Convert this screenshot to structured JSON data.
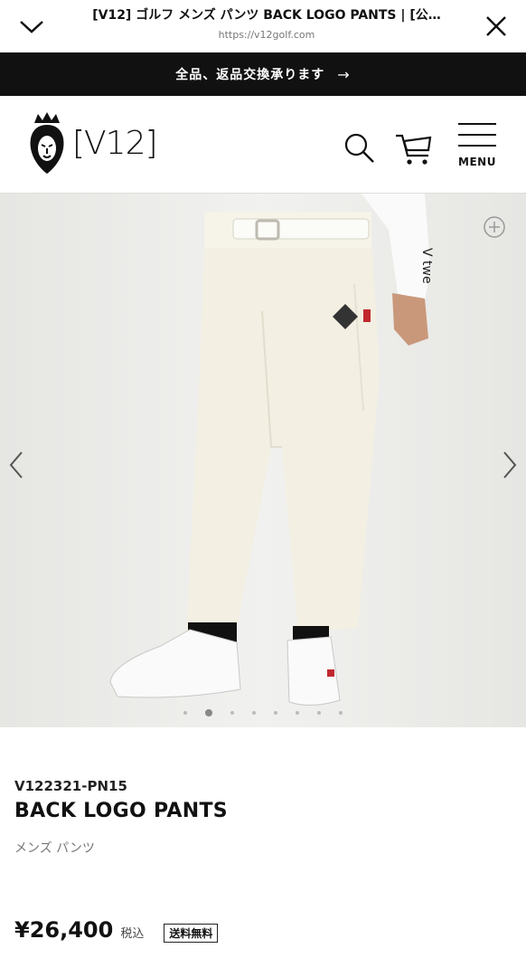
{
  "browser": {
    "title": "[V12] ゴルフ メンズ パンツ BACK LOGO PANTS | [公…",
    "url": "https://v12golf.com"
  },
  "announcement": {
    "text": "全品、返品交換承ります",
    "arrow": "→"
  },
  "site": {
    "logo": "[V12]",
    "menu_label": "MENU"
  },
  "gallery": {
    "image_count": 8,
    "active_index": 1
  },
  "product": {
    "sku": "V122321-PN15",
    "name": "BACK LOGO PANTS",
    "category": "メンズ パンツ",
    "price": "¥26,400",
    "tax_label": "税込",
    "shipping_badge": "送料無料"
  },
  "colors": {
    "announce_bg": "#111111",
    "gallery_bg": "#ececea",
    "pants": "#f3efe2"
  }
}
